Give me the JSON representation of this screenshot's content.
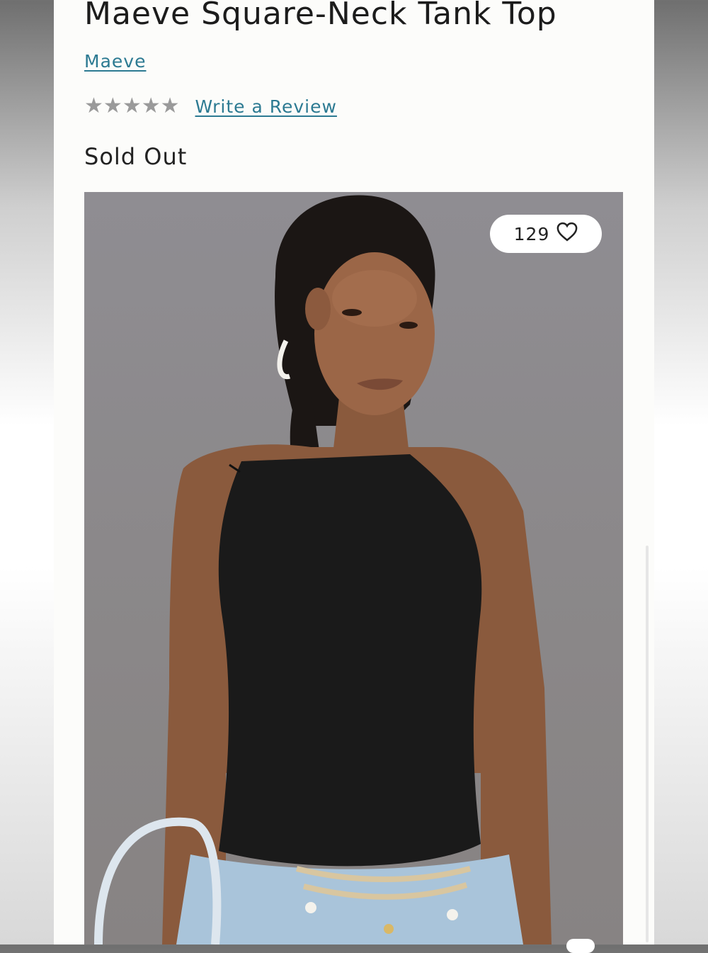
{
  "product": {
    "title": "Maeve Square-Neck Tank Top",
    "brand": "Maeve",
    "rating_stars": 5,
    "rating_filled": 0,
    "review_link": "Write a Review",
    "status": "Sold Out"
  },
  "gallery": {
    "like_count": "129",
    "like_icon": "heart-outline-icon"
  },
  "colors": {
    "link": "#2c7a92",
    "star_empty": "#9a9a9a",
    "photo_background": "#8f8d92",
    "top_color": "#1a1a1a"
  }
}
